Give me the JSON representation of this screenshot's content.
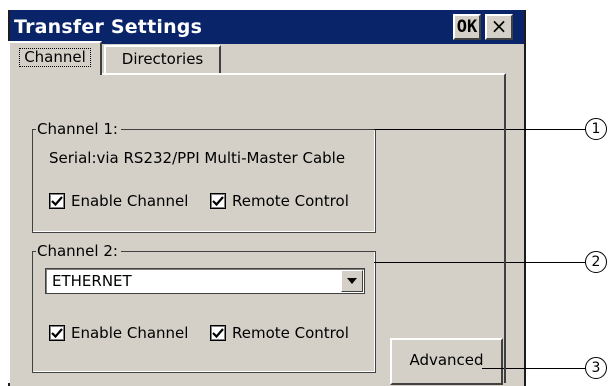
{
  "window": {
    "title": "Transfer Settings",
    "ok_label": "OK",
    "close_label": "×"
  },
  "tabs": [
    {
      "label": "Channel",
      "selected": true
    },
    {
      "label": "Directories",
      "selected": false
    }
  ],
  "channel1": {
    "legend": "Channel 1:",
    "connection": "Serial:via RS232/PPI Multi-Master Cable",
    "enable_label": "Enable Channel",
    "enable_checked": true,
    "remote_label": "Remote Control",
    "remote_checked": true
  },
  "channel2": {
    "legend": "Channel 2:",
    "dropdown_value": "ETHERNET",
    "enable_label": "Enable Channel",
    "enable_checked": true,
    "remote_label": "Remote Control",
    "remote_checked": true
  },
  "advanced_label": "Advanced",
  "callouts": [
    "1",
    "2",
    "3"
  ],
  "colors": {
    "titlebar": "#0a246a",
    "face": "#d4d0c8"
  }
}
